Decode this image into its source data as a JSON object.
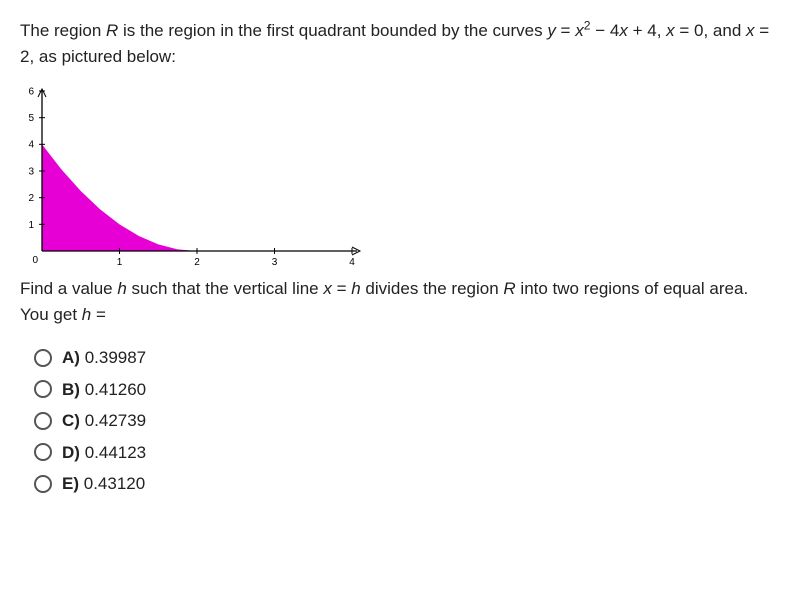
{
  "question": {
    "intro_prefix": "The region ",
    "intro_region_var": "R",
    "intro_after_region": " is the region in the first quadrant bounded by the curves ",
    "eq_y": "y",
    "eq_eq": " = ",
    "eq_x": "x",
    "eq_exp": "2",
    "eq_rest": " − 4",
    "eq_x2": "x",
    "eq_plus4": " + 4, ",
    "eq_xzero_var": "x",
    "eq_xzero_rest": " = 0, and ",
    "eq_xtwo_var": "x",
    "eq_xtwo_rest": " = 2, as pictured below:",
    "followup_prefix": "Find a value ",
    "followup_h1": "h",
    "followup_mid1": " such that the vertical line ",
    "followup_x": "x",
    "followup_eq": " = ",
    "followup_h2": "h",
    "followup_mid2": " divides the region ",
    "followup_R": "R",
    "followup_mid3": " into two regions of equal area. You get ",
    "followup_h3": "h",
    "followup_end": " ="
  },
  "answers": [
    {
      "label": "A)",
      "value": "0.39987"
    },
    {
      "label": "B)",
      "value": "0.41260"
    },
    {
      "label": "C)",
      "value": "0.42739"
    },
    {
      "label": "D)",
      "value": "0.44123"
    },
    {
      "label": "E)",
      "value": "0.43120"
    }
  ],
  "chart_data": {
    "type": "area",
    "title": "",
    "xlabel": "",
    "ylabel": "",
    "xlim": [
      0,
      4
    ],
    "ylim": [
      0,
      6
    ],
    "xticks": [
      0,
      1,
      2,
      3,
      4
    ],
    "yticks": [
      0,
      1,
      2,
      3,
      4,
      5,
      6
    ],
    "series": [
      {
        "name": "y = x^2 - 4x + 4",
        "x": [
          0,
          0.25,
          0.5,
          0.75,
          1,
          1.25,
          1.5,
          1.75,
          2
        ],
        "y": [
          4,
          3.0625,
          2.25,
          1.5625,
          1,
          0.5625,
          0.25,
          0.0625,
          0
        ]
      }
    ],
    "fill_color": "#e600d6",
    "axis_color": "#000000"
  }
}
